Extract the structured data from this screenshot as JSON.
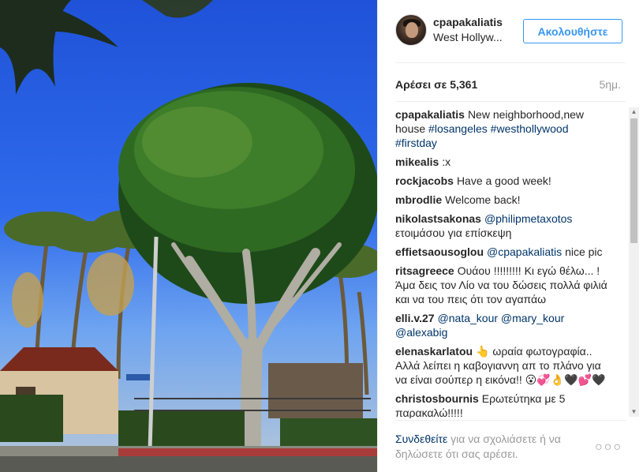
{
  "post": {
    "photo_alt": "Tree under blue sky with palm trees",
    "username": "cpapakaliatis",
    "location": "West Hollyw...",
    "follow_label": "Ακολουθήστε",
    "likes": "Αρέσει σε 5,361",
    "time_ago": "5ημ."
  },
  "comments": [
    {
      "user": "cpapakaliatis",
      "text": "New neighborhood,new house",
      "tags": [
        "#losangeles",
        "#westhollywood",
        "#firstday"
      ]
    },
    {
      "user": "mikealis",
      "text": ":x"
    },
    {
      "user": "rockjacobs",
      "text": "Have a good week!"
    },
    {
      "user": "mbrodlie",
      "text": "Welcome back!"
    },
    {
      "user": "nikolastsakonas",
      "mention": "@philipmetaxotos",
      "text": "ετοιμάσου για επίσκεψη"
    },
    {
      "user": "effietsaousoglou",
      "mention": "@cpapakaliatis",
      "text": "nice pic"
    },
    {
      "user": "ritsagreece",
      "text": "Ουάου !!!!!!!!! Κι εγώ θέλω... ! Άμα δεις τον Λίο να του δώσεις πολλά φιλιά και να του πεις ότι τον αγαπάω"
    },
    {
      "user": "elli.v.27",
      "mention": "@nata_kour @mary_kour @alexabig",
      "text": ""
    },
    {
      "user": "elenaskarlatou",
      "text": "👆 ωραία φωτογραφία.. Αλλά λείπει η καβογιαννη απ το πλάνο για να είναι σούπερ η εικόνα!! 😮💞👌🖤💕🖤"
    },
    {
      "user": "christosbournis",
      "text": "Ερωτεύτηκα με 5 παρακαλώ!!!!!"
    }
  ],
  "login_prompt": {
    "link": "Συνδεθείτε",
    "text": "για να σχολιάσετε ή να δηλώσετε ότι σας αρέσει."
  },
  "more_label": "○○○",
  "colors": {
    "accent": "#3897f0",
    "link": "#003569",
    "muted": "#999999"
  }
}
